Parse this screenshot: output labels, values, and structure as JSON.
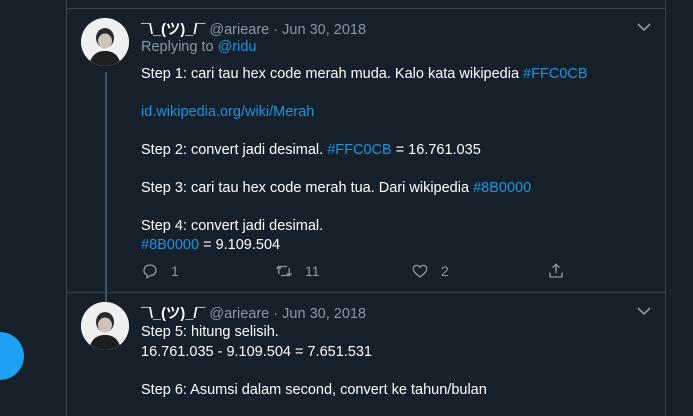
{
  "tweet1": {
    "display_name": "¯\\_(ツ)_/¯",
    "handle": "@arieare",
    "separator": "·",
    "date": "Jun 30, 2018",
    "replying_to_label": "Replying to",
    "replying_to_handle": "@ridu",
    "lines": {
      "l1_text": "Step 1: cari tau hex code merah muda. Kalo kata wikipedia",
      "l1_tag": "#FFC0CB",
      "l2_link": "id.wikipedia.org/wiki/Merah",
      "l3_text": "Step 2: convert jadi desimal.",
      "l3_tag": "#FFC0CB",
      "l3_rest": "= 16.761.035",
      "l4_text": "Step 3: cari tau hex code merah tua. Dari wikipedia",
      "l4_tag": "#8B0000",
      "l5_text": "Step 4: convert jadi desimal.",
      "l6_tag": "#8B0000",
      "l6_rest": "= 9.109.504"
    },
    "replies": "1",
    "retweets": "11",
    "likes": "2"
  },
  "tweet2": {
    "display_name": "¯\\_(ツ)_/¯",
    "handle": "@arieare",
    "separator": "·",
    "date": "Jun 30, 2018",
    "lines": {
      "l1": "Step 5: hitung selisih.",
      "l2": "16.761.035 - 9.109.504 = 7.651.531",
      "l3": "Step 6: Asumsi dalam second, convert ke tahun/bulan"
    }
  },
  "colors": {
    "background": "#15202b",
    "link": "#1b95e0",
    "muted": "#8899a6",
    "border": "#38444d",
    "fab": "#1da1f2"
  },
  "icons": [
    "chevron-down-icon",
    "reply-icon",
    "retweet-icon",
    "like-icon",
    "share-icon",
    "compose-fab"
  ]
}
